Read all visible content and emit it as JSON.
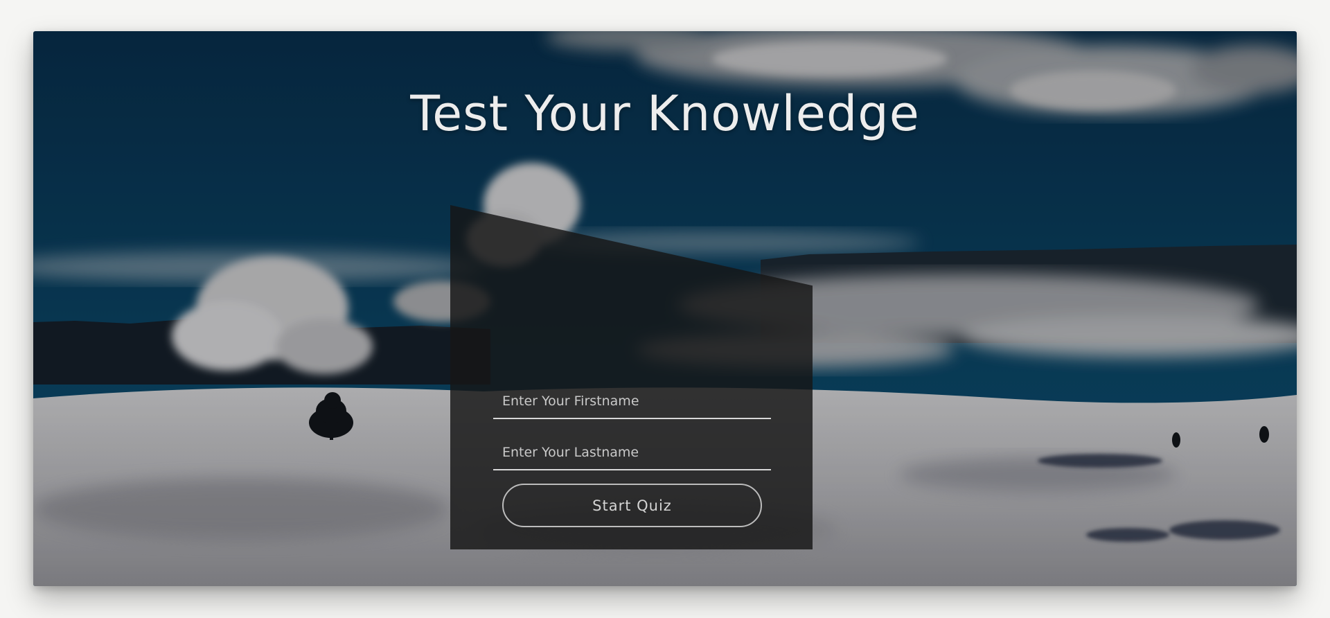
{
  "quiz": {
    "title": "Test Your Knowledge",
    "firstname": {
      "placeholder": "Enter Your Firstname",
      "value": ""
    },
    "lastname": {
      "placeholder": "Enter Your Lastname",
      "value": ""
    },
    "start_label": "Start Quiz"
  },
  "colors": {
    "sky_top": "#0a2e4a",
    "sky_bottom": "#0b4560",
    "snow": "#c9c9cb",
    "panel": "#161616",
    "text": "#ededed"
  }
}
